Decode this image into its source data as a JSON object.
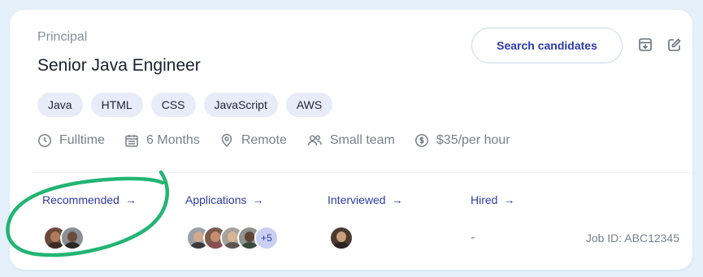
{
  "job": {
    "level": "Principal",
    "title": "Senior Java Engineer",
    "search_button": "Search candidates",
    "tags": [
      "Java",
      "HTML",
      "CSS",
      "JavaScript",
      "AWS"
    ],
    "meta": {
      "type": "Fulltime",
      "duration": "6 Months",
      "location": "Remote",
      "team": "Small team",
      "rate": "$35/per hour"
    },
    "stages": [
      {
        "label": "Recommended",
        "arrow": "→"
      },
      {
        "label": "Applications",
        "arrow": "→",
        "more_count": "+5"
      },
      {
        "label": "Interviewed",
        "arrow": "→"
      },
      {
        "label": "Hired",
        "arrow": "→",
        "empty": "-"
      }
    ],
    "job_id": "Job ID: ABC12345"
  },
  "icons": {
    "archive": "archive-down-icon",
    "edit": "edit-icon",
    "type": "clock-icon",
    "duration": "calendar-icon",
    "location": "location-pin-icon",
    "team": "team-icon",
    "rate": "dollar-coin-icon"
  },
  "colors": {
    "background": "#e4f1fb",
    "card": "#ffffff",
    "accent": "#2e3aa8",
    "tag_bg": "#e8ebf8",
    "muted": "#7a7f8c",
    "highlight": "#22b573"
  }
}
